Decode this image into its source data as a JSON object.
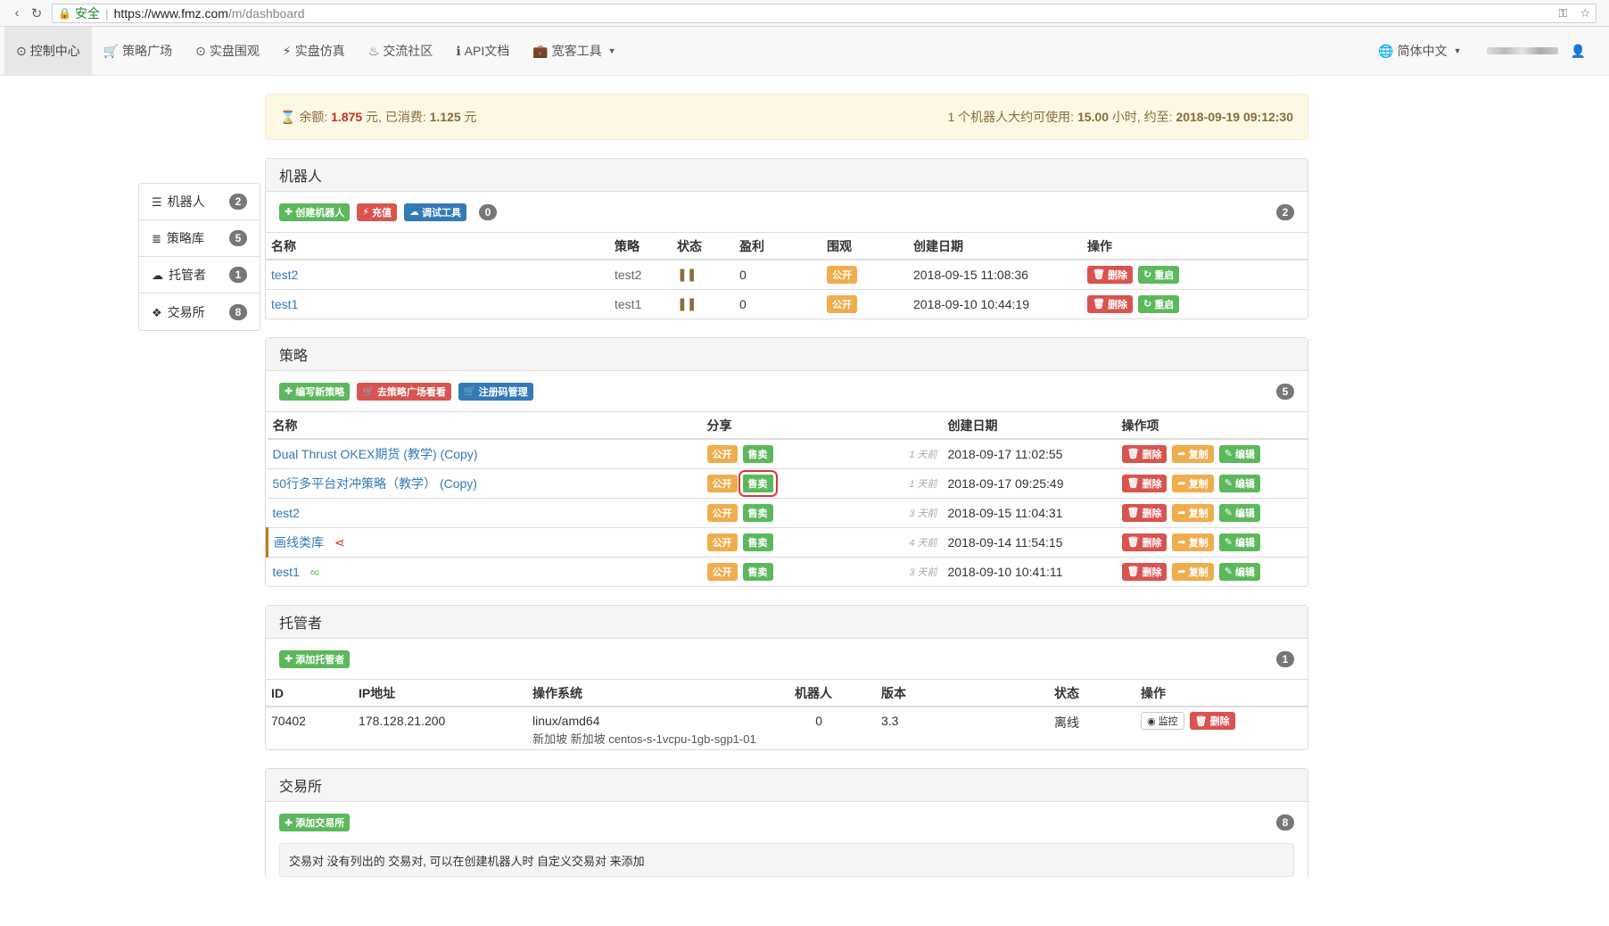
{
  "browser": {
    "secure_label": "安全",
    "url_host": "https://www.fmz.com",
    "url_path": "/m/dashboard"
  },
  "nav": {
    "items": [
      {
        "label": "控制中心",
        "icon": "dashboard-icon",
        "glyph": "⊙"
      },
      {
        "label": "策略广场",
        "icon": "cart-icon",
        "glyph": "🛒"
      },
      {
        "label": "实盘围观",
        "icon": "eye-circle-icon",
        "glyph": "⊙"
      },
      {
        "label": "实盘仿真",
        "icon": "bolt-icon",
        "glyph": "⚡"
      },
      {
        "label": "交流社区",
        "icon": "fire-icon",
        "glyph": "♨"
      },
      {
        "label": "API文档",
        "icon": "info-icon",
        "glyph": "ℹ"
      },
      {
        "label": "宽客工具",
        "icon": "briefcase-icon",
        "glyph": "💼"
      }
    ],
    "language": "简体中文"
  },
  "sidebar": {
    "items": [
      {
        "label": "机器人",
        "count": "2"
      },
      {
        "label": "策略库",
        "count": "5"
      },
      {
        "label": "托管者",
        "count": "1"
      },
      {
        "label": "交易所",
        "count": "8"
      }
    ]
  },
  "balance": {
    "prefix": "余额:",
    "amount": "1.875",
    "unit1": "元, 已消费:",
    "spent": "1.125",
    "unit2": "元",
    "right_prefix": "1 个机器人大约可使用:",
    "hours": "15.00",
    "right_mid": "小时, 约至:",
    "until": "2018-09-19 09:12:30"
  },
  "robots": {
    "title": "机器人",
    "create_label": "创建机器人",
    "recharge_label": "充值",
    "debug_label": "调试工具",
    "debug_count": "0",
    "count": "2",
    "headers": [
      "名称",
      "策略",
      "状态",
      "盈利",
      "围观",
      "创建日期",
      "操作"
    ],
    "rows": [
      {
        "name": "test2",
        "strategy": "test2",
        "status": "❚❚",
        "profit": "0",
        "watch": "公开",
        "created": "2018-09-15 11:08:36"
      },
      {
        "name": "test1",
        "strategy": "test1",
        "status": "❚❚",
        "profit": "0",
        "watch": "公开",
        "created": "2018-09-10 10:44:19"
      }
    ],
    "delete_label": "删除",
    "restart_label": "重启"
  },
  "strategies": {
    "title": "策略",
    "write_label": "编写新策略",
    "market_label": "去策略广场看看",
    "regcode_label": "注册码管理",
    "count": "5",
    "headers": [
      "名称",
      "分享",
      "",
      "创建日期",
      "操作项"
    ],
    "public_label": "公开",
    "sell_label": "售卖",
    "delete_label": "删除",
    "copy_label": "复制",
    "edit_label": "编辑",
    "rows": [
      {
        "name": "Dual Thrust OKEX期货 (教学) (Copy)",
        "ago": "1 天前",
        "created": "2018-09-17 11:02:55"
      },
      {
        "name": "50行多平台对冲策略（教学） (Copy)",
        "ago": "1 天前",
        "created": "2018-09-17 09:25:49"
      },
      {
        "name": "test2",
        "ago": "3 天前",
        "created": "2018-09-15 11:04:31"
      },
      {
        "name": "画线类库",
        "ago": "4 天前",
        "created": "2018-09-14 11:54:15"
      },
      {
        "name": "test1",
        "ago": "3 天前",
        "created": "2018-09-10 10:41:11"
      }
    ]
  },
  "dockers": {
    "title": "托管者",
    "add_label": "添加托管者",
    "count": "1",
    "headers": [
      "ID",
      "IP地址",
      "操作系统",
      "机器人",
      "版本",
      "状态",
      "操作"
    ],
    "row": {
      "id": "70402",
      "ip": "178.128.21.200",
      "os": "linux/amd64",
      "os_sub": "新加坡 新加坡   centos-s-1vcpu-1gb-sgp1-01",
      "robots": "0",
      "version": "3.3",
      "status": "离线",
      "monitor_label": "监控",
      "delete_label": "删除"
    }
  },
  "exchanges": {
    "title": "交易所",
    "add_label": "添加交易所",
    "count": "8",
    "note": "交易对 没有列出的 交易对, 可以在创建机器人时 自定义交易对 来添加"
  }
}
